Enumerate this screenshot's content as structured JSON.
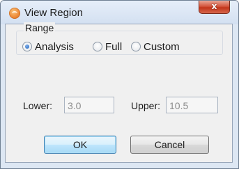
{
  "window": {
    "title": "View Region",
    "icon": "app-logo-icon",
    "close_glyph": "x"
  },
  "range": {
    "label": "Range",
    "selected": "Analysis",
    "options": [
      {
        "label": "Analysis",
        "checked": true
      },
      {
        "label": "Full",
        "checked": false
      },
      {
        "label": "Custom",
        "checked": false
      }
    ]
  },
  "fields": {
    "lower": {
      "label": "Lower:",
      "value": "3.0"
    },
    "upper": {
      "label": "Upper:",
      "value": "10.5"
    }
  },
  "buttons": {
    "ok": "OK",
    "cancel": "Cancel"
  },
  "colors": {
    "accent": "#3c7fb1",
    "close": "#c2351b",
    "title_bg": "#dde7f3"
  }
}
